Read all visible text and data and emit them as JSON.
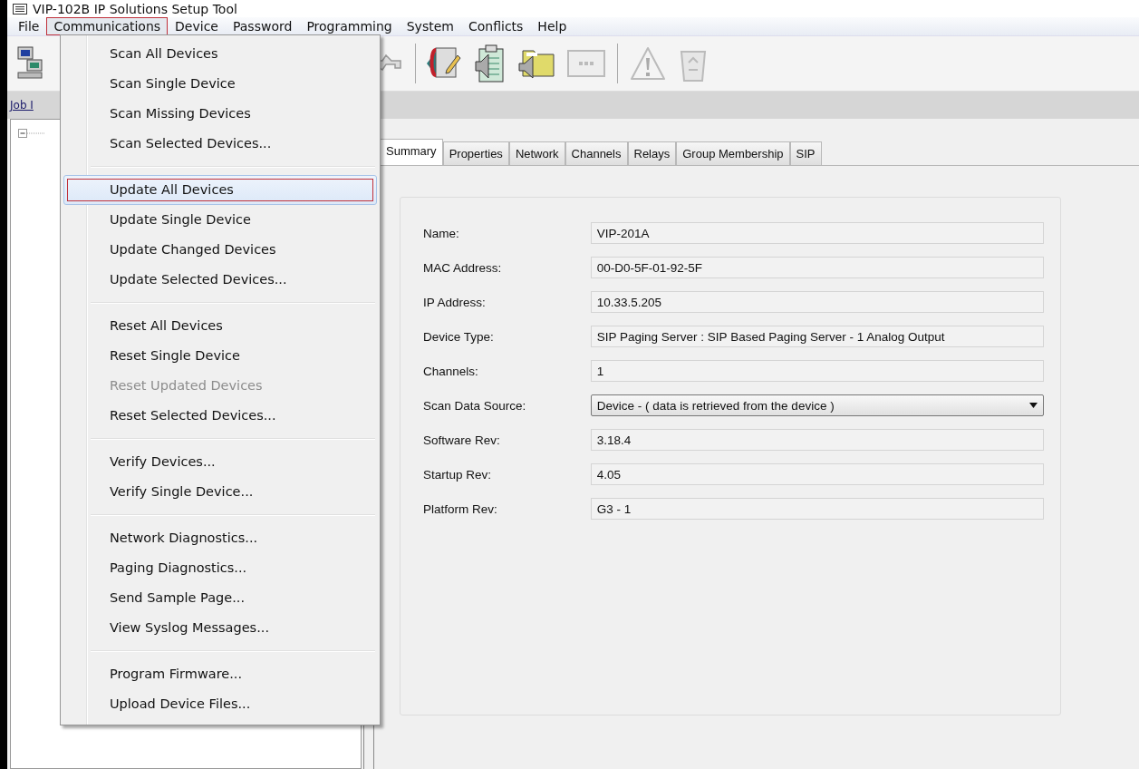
{
  "window": {
    "title": "VIP-102B IP Solutions Setup Tool"
  },
  "menu_bar": [
    {
      "label": "File",
      "selected": false
    },
    {
      "label": "Communications",
      "selected": true
    },
    {
      "label": "Device",
      "selected": false
    },
    {
      "label": "Password",
      "selected": false
    },
    {
      "label": "Programming",
      "selected": false
    },
    {
      "label": "System",
      "selected": false
    },
    {
      "label": "Conflicts",
      "selected": false
    },
    {
      "label": "Help",
      "selected": false
    }
  ],
  "job_link": "Job I",
  "tabs": [
    {
      "label": "Summary",
      "selected": true
    },
    {
      "label": "Properties",
      "selected": false
    },
    {
      "label": "Network",
      "selected": false
    },
    {
      "label": "Channels",
      "selected": false
    },
    {
      "label": "Relays",
      "selected": false
    },
    {
      "label": "Group Membership",
      "selected": false
    },
    {
      "label": "SIP",
      "selected": false
    }
  ],
  "fields": [
    {
      "label": "Name:",
      "value": "VIP-201A",
      "kind": "text"
    },
    {
      "label": "MAC Address:",
      "value": "00-D0-5F-01-92-5F",
      "kind": "text"
    },
    {
      "label": "IP Address:",
      "value": "10.33.5.205",
      "kind": "text"
    },
    {
      "label": "Device Type:",
      "value": "SIP Paging Server : SIP Based Paging Server - 1 Analog Output",
      "kind": "text"
    },
    {
      "label": "Channels:",
      "value": "1",
      "kind": "text"
    },
    {
      "label": "Scan Data Source:",
      "value": "Device - ( data is retrieved from the device )",
      "kind": "dropdown"
    },
    {
      "label": "Software Rev:",
      "value": "3.18.4",
      "kind": "text"
    },
    {
      "label": "Startup Rev:",
      "value": "4.05",
      "kind": "text"
    },
    {
      "label": "Platform Rev:",
      "value": "G3 - 1",
      "kind": "text"
    }
  ],
  "menu": [
    {
      "items": [
        {
          "label": "Scan All Devices",
          "selected": false,
          "disabled": false
        },
        {
          "label": "Scan Single Device",
          "selected": false,
          "disabled": false
        },
        {
          "label": "Scan Missing Devices",
          "selected": false,
          "disabled": false
        },
        {
          "label": "Scan Selected Devices...",
          "selected": false,
          "disabled": false
        }
      ]
    },
    {
      "items": [
        {
          "label": "Update All Devices",
          "selected": true,
          "disabled": false
        },
        {
          "label": "Update Single Device",
          "selected": false,
          "disabled": false
        },
        {
          "label": "Update Changed Devices",
          "selected": false,
          "disabled": false
        },
        {
          "label": "Update Selected Devices...",
          "selected": false,
          "disabled": false
        }
      ]
    },
    {
      "items": [
        {
          "label": "Reset All Devices",
          "selected": false,
          "disabled": false
        },
        {
          "label": "Reset Single Device",
          "selected": false,
          "disabled": false
        },
        {
          "label": "Reset Updated Devices",
          "selected": false,
          "disabled": true
        },
        {
          "label": "Reset Selected Devices...",
          "selected": false,
          "disabled": false
        }
      ]
    },
    {
      "items": [
        {
          "label": "Verify Devices...",
          "selected": false,
          "disabled": false
        },
        {
          "label": "Verify Single Device...",
          "selected": false,
          "disabled": false
        }
      ]
    },
    {
      "items": [
        {
          "label": "Network Diagnostics...",
          "selected": false,
          "disabled": false
        },
        {
          "label": "Paging Diagnostics...",
          "selected": false,
          "disabled": false
        },
        {
          "label": "Send Sample Page...",
          "selected": false,
          "disabled": false
        },
        {
          "label": "View Syslog Messages...",
          "selected": false,
          "disabled": false
        }
      ]
    },
    {
      "items": [
        {
          "label": "Program Firmware...",
          "selected": false,
          "disabled": false
        },
        {
          "label": "Upload Device Files...",
          "selected": false,
          "disabled": false
        }
      ]
    }
  ]
}
